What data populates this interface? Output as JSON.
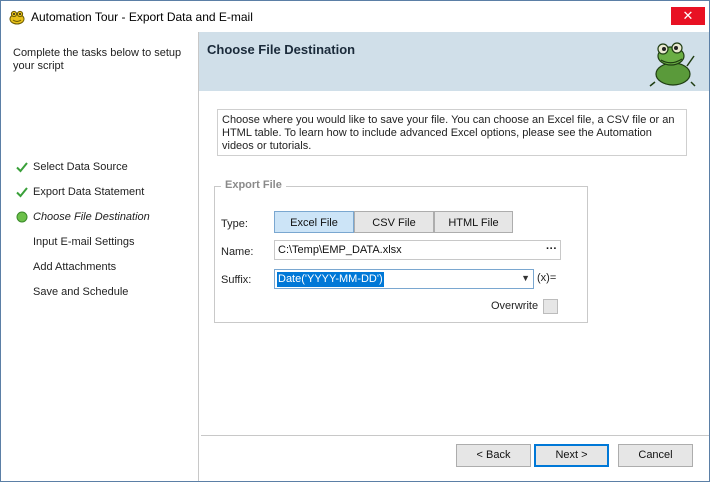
{
  "window": {
    "title": "Automation Tour - Export Data and E-mail",
    "close_glyph": "✕"
  },
  "sidebar": {
    "intro": "Complete the tasks below to setup your script",
    "steps": [
      {
        "label": "Select Data Source",
        "state": "done"
      },
      {
        "label": "Export Data Statement",
        "state": "done"
      },
      {
        "label": "Choose File Destination",
        "state": "current"
      },
      {
        "label": "Input E-mail Settings",
        "state": "pending"
      },
      {
        "label": "Add Attachments",
        "state": "pending"
      },
      {
        "label": "Save and Schedule",
        "state": "pending"
      }
    ]
  },
  "header": {
    "title": "Choose File Destination"
  },
  "description": "Choose where you would like to save your file. You can choose an Excel file, a CSV file or an HTML table. To learn how to include advanced Excel options, please see the Automation videos or tutorials.",
  "export_file": {
    "legend": "Export File",
    "type_label": "Type:",
    "types": [
      "Excel File",
      "CSV File",
      "HTML File"
    ],
    "selected_type": "Excel File",
    "name_label": "Name:",
    "name_value": "C:\\Temp\\EMP_DATA.xlsx",
    "ellipsis": "···",
    "suffix_label": "Suffix:",
    "suffix_value": "Date('YYYY-MM-DD')",
    "fx_label": "(x)=",
    "overwrite_label": "Overwrite",
    "overwrite_checked": false
  },
  "buttons": {
    "back": "< Back",
    "next": "Next >",
    "cancel": "Cancel"
  },
  "colors": {
    "header_bg": "#d0dfe9",
    "close_bg": "#e81123",
    "selection": "#0078d7",
    "check_green": "#3aa03a"
  }
}
